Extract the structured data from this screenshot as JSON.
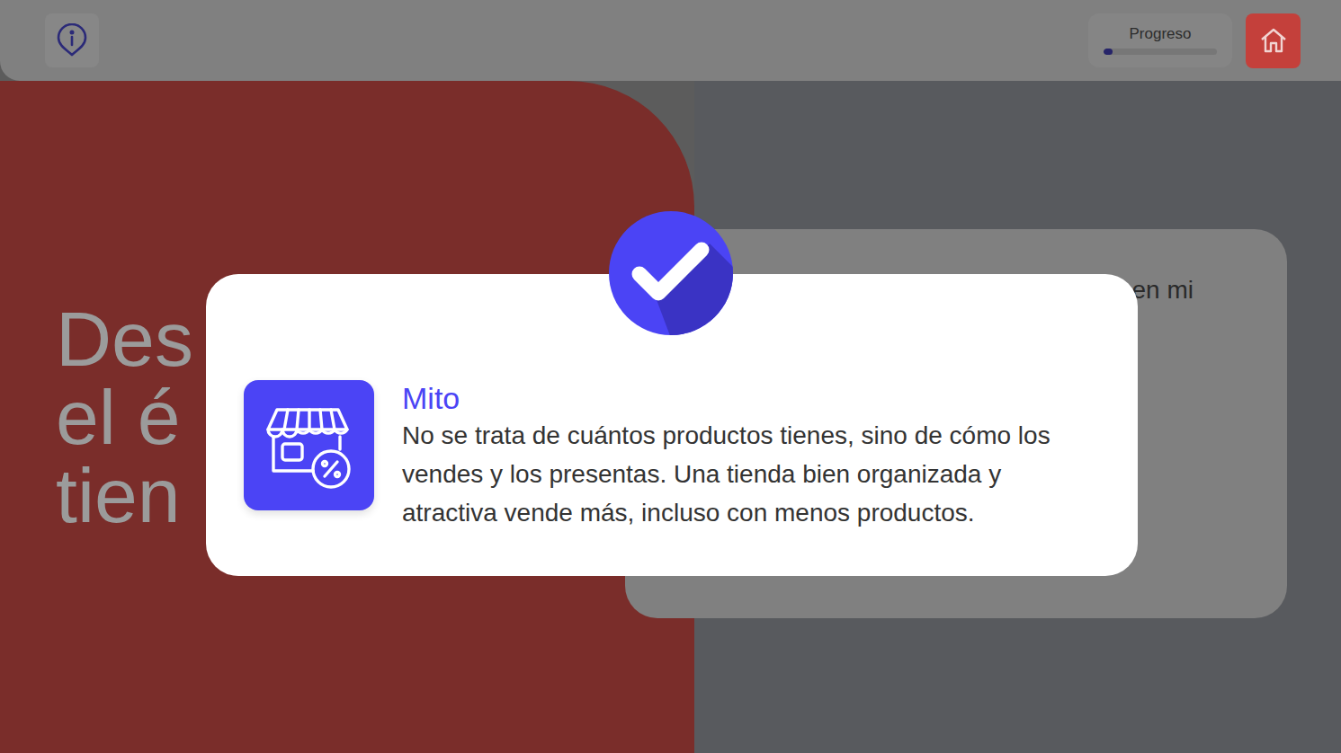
{
  "topbar": {
    "progress": {
      "label": "Progreso",
      "level": 0.03
    }
  },
  "hero": {
    "title_lines": [
      "Des",
      "el é",
      "tien"
    ]
  },
  "card": {
    "text": "en mi"
  },
  "modal": {
    "title": "Mito",
    "body": "No se trata de cuántos productos tienes, sino de cómo los vendes y los presentas. Una tienda bien organizada y atractiva vende más, incluso con menos productos."
  }
}
